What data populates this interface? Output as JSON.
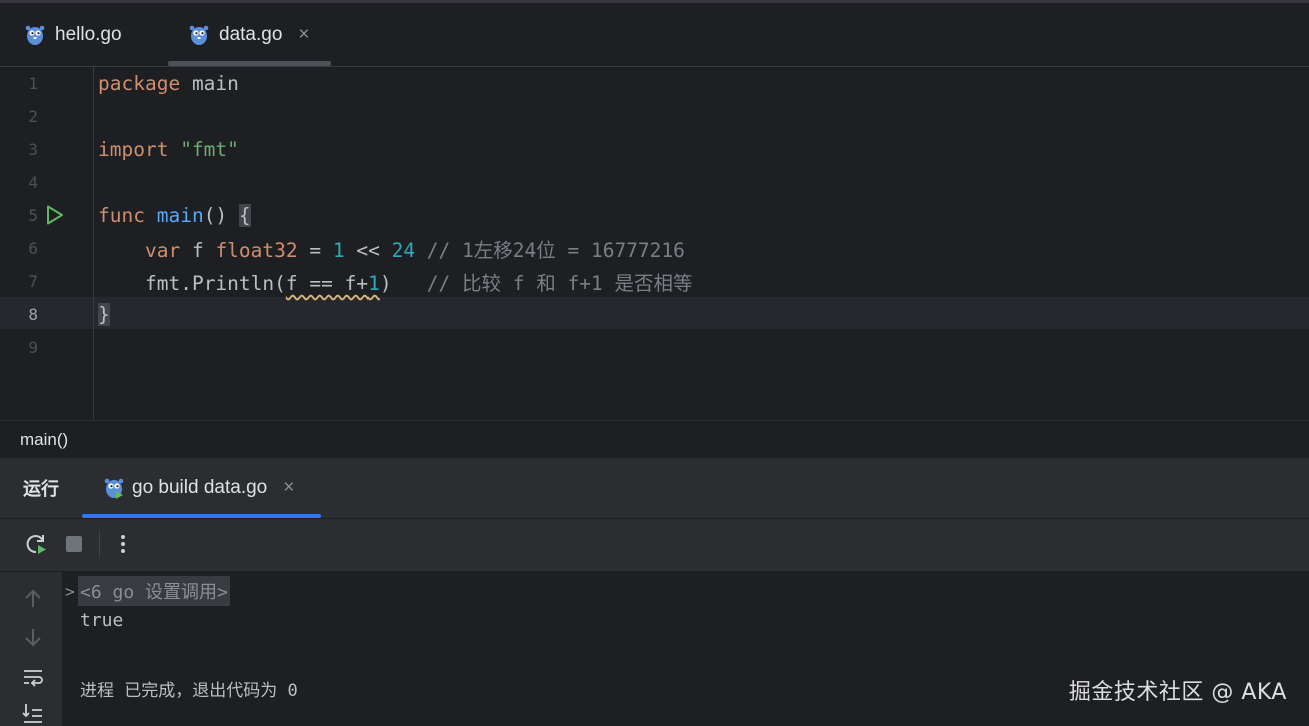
{
  "editor_tabs": [
    {
      "label": "hello.go",
      "active": false
    },
    {
      "label": "data.go",
      "active": true,
      "close": "×"
    }
  ],
  "code_lines": [
    {
      "num": "1"
    },
    {
      "num": "2"
    },
    {
      "num": "3"
    },
    {
      "num": "4"
    },
    {
      "num": "5"
    },
    {
      "num": "6"
    },
    {
      "num": "7"
    },
    {
      "num": "8"
    },
    {
      "num": "9"
    }
  ],
  "code": {
    "l1": {
      "kw": "package",
      "name": "main"
    },
    "l3": {
      "kw": "import",
      "str": "\"fmt\""
    },
    "l5": {
      "kw": "func",
      "fn": "main",
      "rest": "() ",
      "brace": "{"
    },
    "l6": {
      "indent": "    ",
      "kw": "var",
      "ident": " f ",
      "typ": "float32",
      "op1": " = ",
      "n1": "1",
      "op2": " << ",
      "n2": "24",
      "comment": " // 1左移24位 = 16777216"
    },
    "l7": {
      "indent": "    ",
      "pkg": "fmt",
      "dot": ".",
      "fn": "Println",
      "open": "(",
      "warn": "f == f+",
      "n": "1",
      "close": ")",
      "comment": "   // 比较 f 和 f+1 是否相等"
    },
    "l8": {
      "brace": "}"
    }
  },
  "breadcrumb": "main()",
  "run_panel": {
    "title": "运行",
    "tab_label": "go build data.go",
    "tab_close": "×"
  },
  "console": {
    "folded_header": "<6 go 设置调用>",
    "output": "true",
    "exit_message": "进程 已完成，退出代码为 0"
  },
  "watermark": "掘金技术社区 @ AKA",
  "icons": {
    "gutter_run": "play-icon",
    "toolbar": [
      "rerun-icon",
      "stop-icon",
      "more-vertical-icon"
    ],
    "side": [
      "arrow-up-icon",
      "arrow-down-icon",
      "soft-wrap-icon",
      "scroll-to-end-icon"
    ]
  },
  "colors": {
    "background": "#1e1f22",
    "keyword": "#cf8e6d",
    "string": "#6aab73",
    "function": "#56a8f5",
    "number": "#2aacb8",
    "comment": "#7a7e85",
    "accent": "#3574f0"
  }
}
